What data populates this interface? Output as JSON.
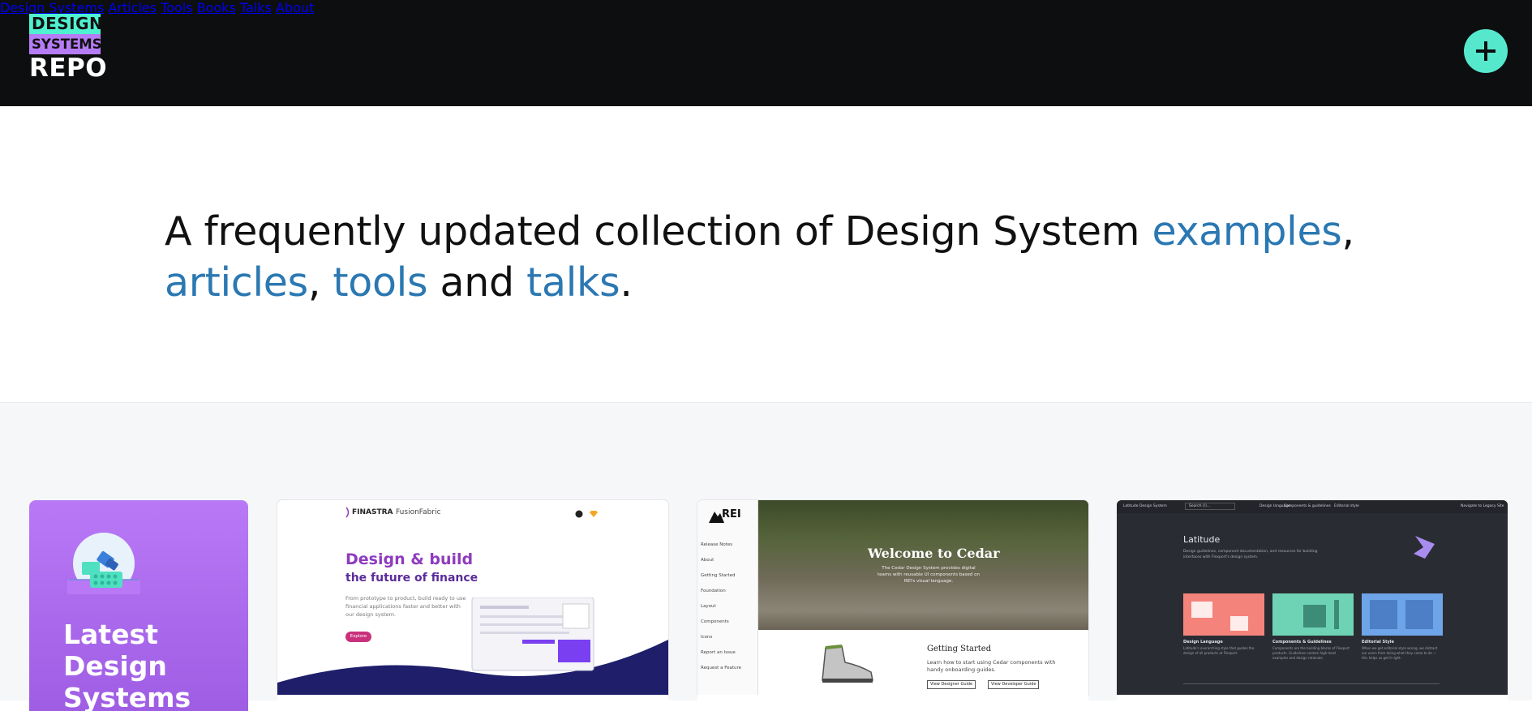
{
  "logo": {
    "line1": "DESIGN",
    "line2": "SYSTEMS",
    "line3": "REPO"
  },
  "nav": {
    "items": [
      "Design Systems",
      "Articles",
      "Tools",
      "Books",
      "Talks",
      "About"
    ]
  },
  "add_button": {
    "icon": "plus-icon"
  },
  "hero": {
    "text_before": "A frequently updated collection of Design System ",
    "link_examples": "examples",
    "sep1": ",",
    "link_articles": "articles",
    "sep2": ", ",
    "link_tools": "tools",
    "text_and": " and ",
    "link_talks": "talks",
    "end": "."
  },
  "feature_card": {
    "title": "Latest Design Systems",
    "icon": "blocks-badge-icon"
  },
  "cards": [
    {
      "name": "finastra",
      "logo": "FINASTRA",
      "logo2": "FusionFabric",
      "heading1": "Design & build",
      "heading2": "the future of finance",
      "paragraph": "From prototype to product, build ready to use financial applications faster and better with our design system.",
      "button": "Explore"
    },
    {
      "name": "cedar",
      "logo": "REI",
      "nav": [
        "Release Notes",
        "About",
        "Getting Started",
        "Foundation",
        "Layout",
        "Components",
        "Icons",
        "Report an Issue",
        "Request a Feature"
      ],
      "heading": "Welcome to Cedar",
      "subtitle": "The Cedar Design System provides digital teams with reusable UI components based on REI's visual language.",
      "getting_started": "Getting Started",
      "getting_started_text": "Learn how to start using Cedar components with handy onboarding guides.",
      "btn1": "View Designer Guide",
      "btn2": "View Developer Guide"
    },
    {
      "name": "latitude",
      "top_brand": "Latitude Design System",
      "top_search": "Search (/)...",
      "top_links": [
        "Design language",
        "Components & guidelines",
        "Editorial style"
      ],
      "top_right": "Navigate to Legacy Site",
      "heading": "Latitude",
      "paragraph": "Design guidelines, component documentation, and resources for building interfaces with Flexport's design system.",
      "tiles": [
        {
          "label": "Design Language",
          "text": "Latitude's overarching style that guides the design of all products at Flexport."
        },
        {
          "label": "Components & Guidelines",
          "text": "Components are the building blocks of Flexport products. Guidelines contain high-level examples and design rationale."
        },
        {
          "label": "Editorial Style",
          "text": "When we get editorial style wrong, we distract our users from doing what they came to do — this helps us get it right."
        }
      ]
    }
  ],
  "colors": {
    "header_bg": "#0d0e0f",
    "accent_teal": "#4ef2d0",
    "accent_purple": "#b57cf6",
    "link_blue": "#2b78b2"
  }
}
